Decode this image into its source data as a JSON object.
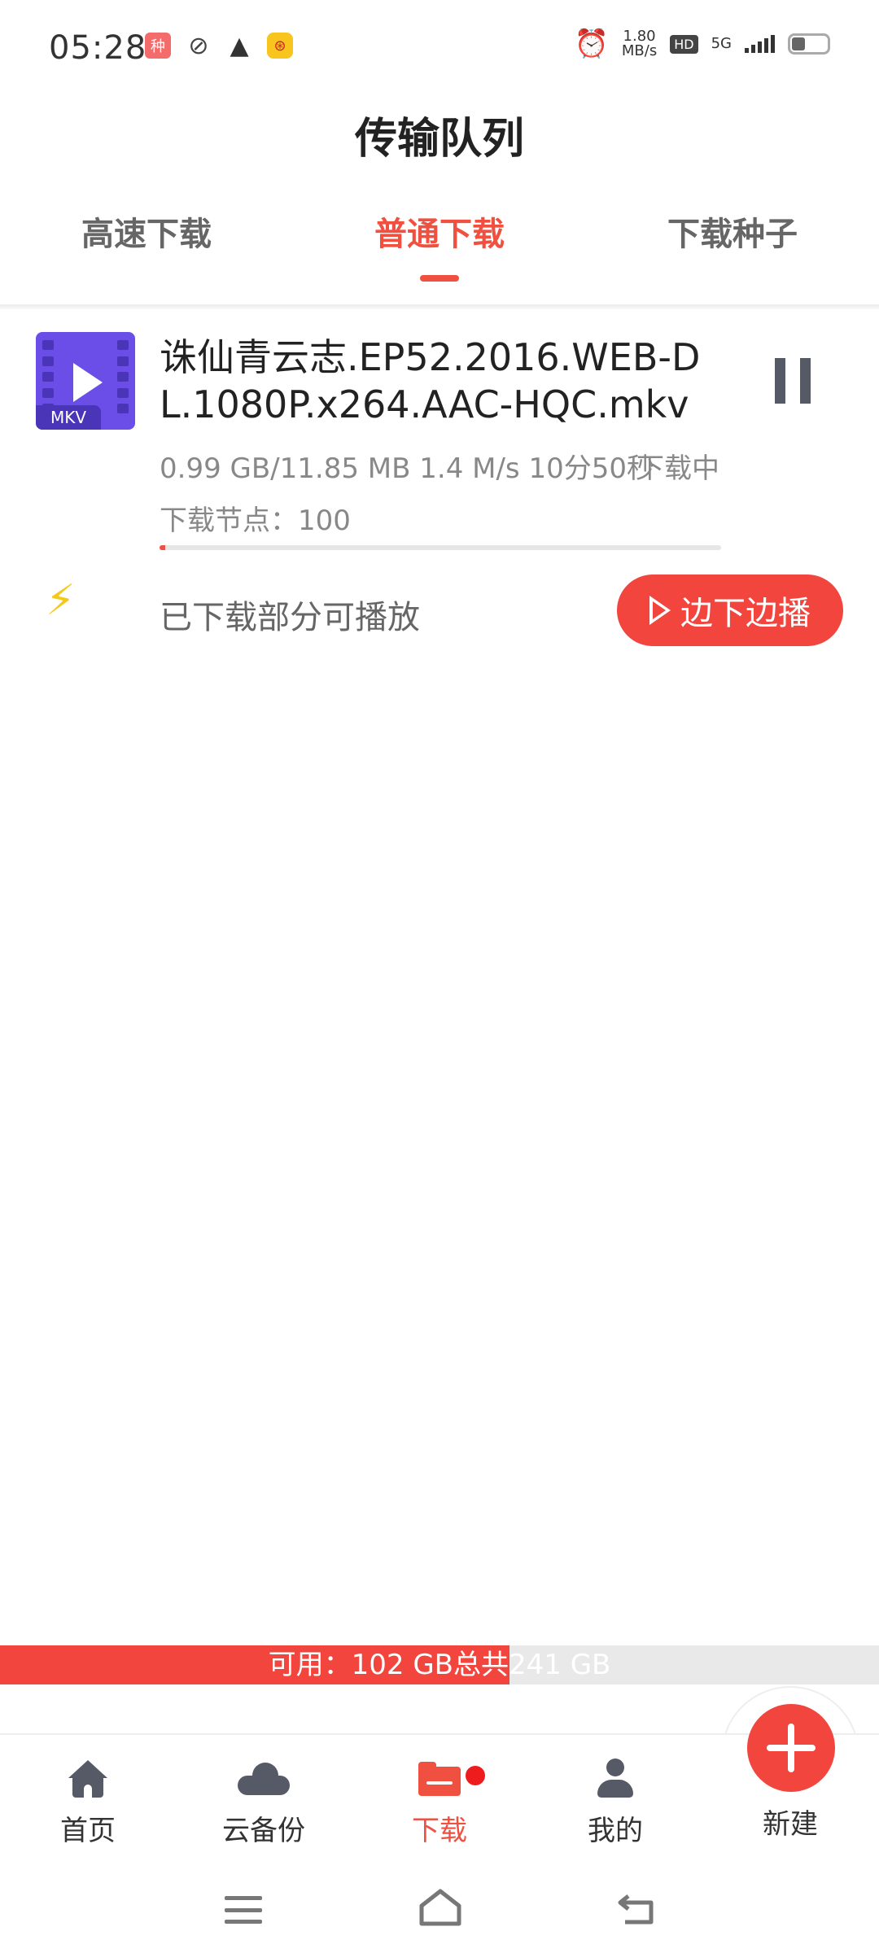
{
  "status_bar": {
    "time": "05:28",
    "left_icons": [
      "seed-app-icon",
      "leaf-icon",
      "warning-icon",
      "yellow-app-icon"
    ],
    "seed_icon_text": "种",
    "speed_value": "1.80",
    "speed_unit": "MB/s",
    "hd_label": "HD",
    "network_label": "5G"
  },
  "header": {
    "title": "传输队列"
  },
  "tabs": [
    {
      "label": "高速下载",
      "active": false
    },
    {
      "label": "普通下载",
      "active": true
    },
    {
      "label": "下载种子",
      "active": false
    }
  ],
  "download": {
    "thumb_badge": "MKV",
    "file_name": "诛仙青云志.EP52.2016.WEB-DL.1080P.x264.AAC-HQC.mkv",
    "stats": "0.99 GB/11.85 MB 1.4 M/s 10分50秒",
    "status": "下载中",
    "nodes": "下载节点：100",
    "progress": 0.01,
    "play_hint": "已下载部分可播放",
    "stream_button": "边下边播"
  },
  "storage": {
    "text": "可用：102 GB总共241 GB",
    "used_fraction": 0.58
  },
  "bottom_nav": [
    {
      "label": "首页",
      "icon": "home-icon"
    },
    {
      "label": "云备份",
      "icon": "cloud-icon"
    },
    {
      "label": "下载",
      "icon": "folder-icon",
      "active": true,
      "has_badge": true
    },
    {
      "label": "我的",
      "icon": "person-icon"
    }
  ],
  "fab": {
    "label": "新建",
    "icon": "plus-icon"
  },
  "colors": {
    "accent": "#f05040",
    "button": "#f1453d",
    "thumb": "#6b4ee8",
    "bolt": "#f4c91b"
  }
}
